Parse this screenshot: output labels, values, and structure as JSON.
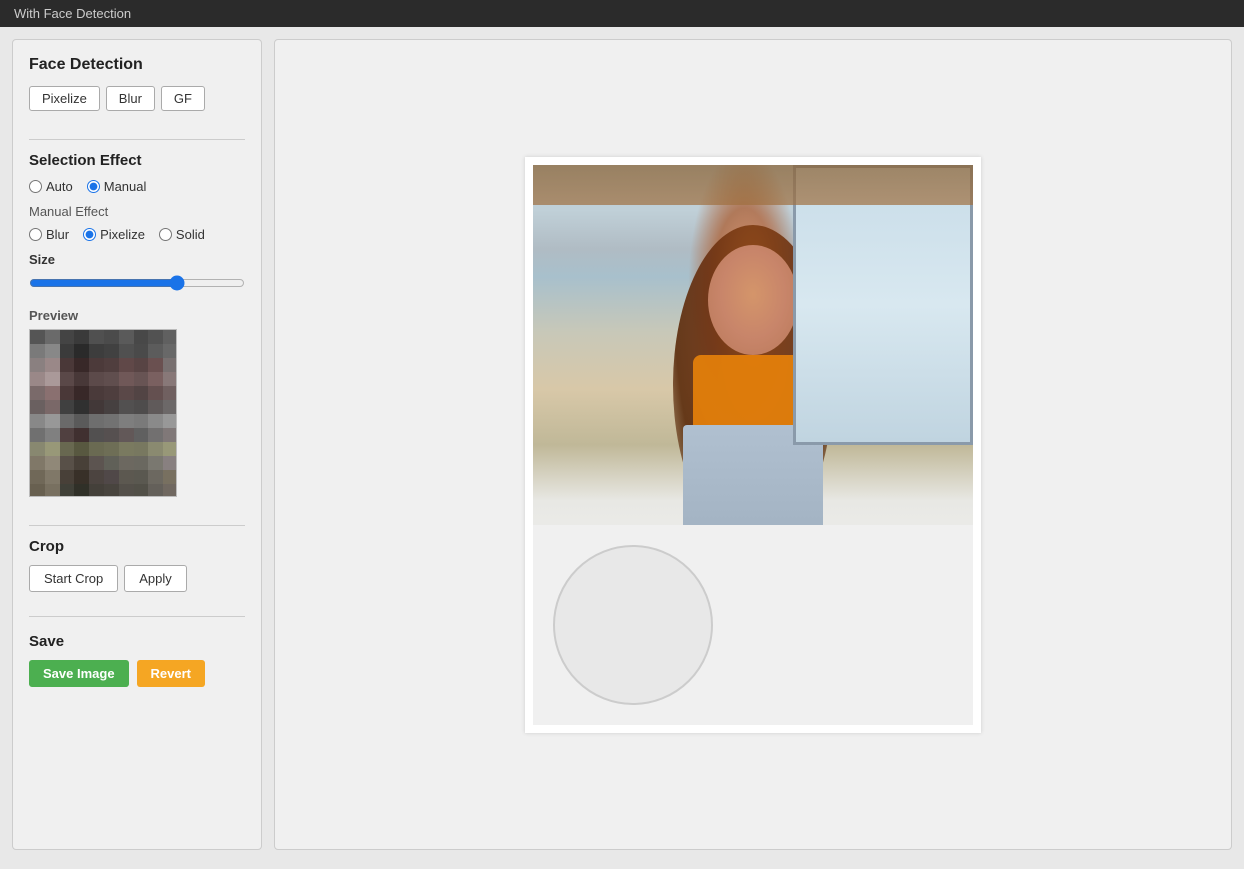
{
  "topbar": {
    "title": "With Face Detection"
  },
  "leftPanel": {
    "faceDetection": {
      "title": "Face Detection",
      "buttons": [
        "Pixelize",
        "Blur",
        "GF"
      ]
    },
    "selectionEffect": {
      "title": "Selection Effect",
      "options": [
        "Auto",
        "Manual"
      ],
      "selectedOption": "Manual"
    },
    "manualEffect": {
      "label": "Manual Effect",
      "options": [
        "Blur",
        "Pixelize",
        "Solid"
      ],
      "selectedOption": "Pixelize"
    },
    "size": {
      "label": "Size",
      "value": 70
    },
    "preview": {
      "label": "Preview"
    },
    "crop": {
      "title": "Crop",
      "startCropLabel": "Start Crop",
      "applyLabel": "Apply"
    },
    "save": {
      "title": "Save",
      "saveImageLabel": "Save Image",
      "revertLabel": "Revert"
    }
  },
  "pixelColors": [
    "#555555",
    "#6a6a6a",
    "#444444",
    "#3a3a3a",
    "#505050",
    "#4b4b4b",
    "#5a5a5a",
    "#484848",
    "#525252",
    "#606060",
    "#7a7a7a",
    "#888888",
    "#3b3b3b",
    "#2a2a2a",
    "#3d3d3d",
    "#414141",
    "#505050",
    "#4a4a4a",
    "#5c5c5c",
    "#686868",
    "#8a8080",
    "#9a8888",
    "#4a3838",
    "#382828",
    "#4c3a3a",
    "#503e3e",
    "#604848",
    "#584444",
    "#6a5050",
    "#787070",
    "#9a8888",
    "#aa9999",
    "#5a4848",
    "#483838",
    "#5c4a4a",
    "#604e4e",
    "#705858",
    "#685454",
    "#7a6060",
    "#887878",
    "#7a6a6a",
    "#8a7070",
    "#4a3838",
    "#382828",
    "#4a3a3a",
    "#4e3e3e",
    "#5a4848",
    "#524444",
    "#645050",
    "#706060",
    "#6a6060",
    "#7a6868",
    "#404040",
    "#303030",
    "#423838",
    "#464040",
    "#525050",
    "#4e4c4c",
    "#605a5a",
    "#6c6868",
    "#888888",
    "#989898",
    "#6a6a6a",
    "#5a5a5a",
    "#6e6e6e",
    "#727272",
    "#7e7e7e",
    "#7a7a7a",
    "#8a8a8a",
    "#989898",
    "#707070",
    "#808080",
    "#504040",
    "#403030",
    "#525050",
    "#565050",
    "#625858",
    "#606060",
    "#727070",
    "#807878",
    "#888870",
    "#989878",
    "#686850",
    "#585840",
    "#6a6a52",
    "#6e6e56",
    "#7a7a60",
    "#787860",
    "#8a8a70",
    "#989878",
    "#807868",
    "#908878",
    "#585048",
    "#484038",
    "#5c5450",
    "#606058",
    "#6c6860",
    "#6a6860",
    "#7a7870",
    "#888080",
    "#706858",
    "#807868",
    "#484038",
    "#383028",
    "#4c4440",
    "#504848",
    "#5c5850",
    "#5a5850",
    "#6c6860",
    "#787060",
    "#686050",
    "#787060",
    "#404038",
    "#303028",
    "#44403a",
    "#48443e",
    "#54504a",
    "#525048",
    "#64605a",
    "#706860"
  ]
}
